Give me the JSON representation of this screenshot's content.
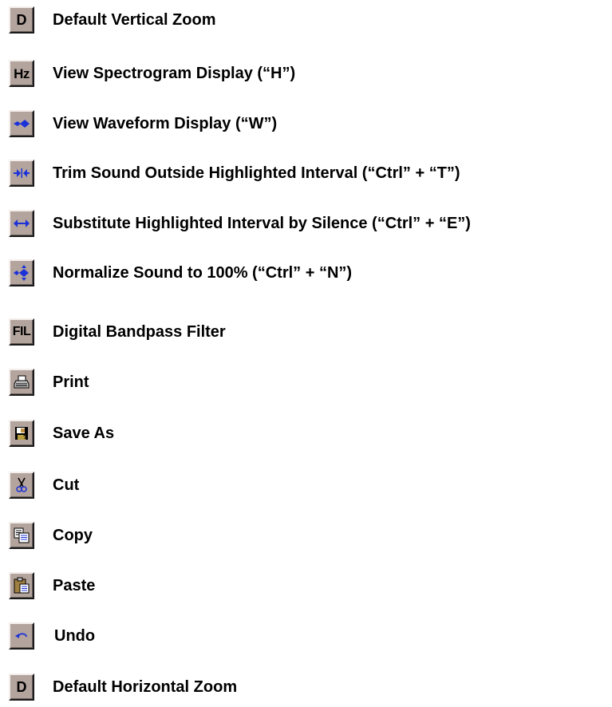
{
  "legend": {
    "items": [
      {
        "icon": "default-vertical-zoom-icon",
        "glyph": "D",
        "label": "Default Vertical Zoom"
      },
      {
        "icon": "spectrogram-icon",
        "glyph": "Hz",
        "label": "View Spectrogram Display (“H”)"
      },
      {
        "icon": "waveform-icon",
        "label": "View Waveform Display (“W”)"
      },
      {
        "icon": "trim-icon",
        "label": "Trim Sound Outside Highlighted Interval (“Ctrl” + “T”)"
      },
      {
        "icon": "silence-icon",
        "label": "Substitute Highlighted Interval by Silence (“Ctrl” + “E”)"
      },
      {
        "icon": "normalize-icon",
        "label": "Normalize Sound to 100% (“Ctrl” + “N”)"
      },
      {
        "icon": "filter-icon",
        "glyph": "FIL",
        "label": "Digital Bandpass Filter"
      },
      {
        "icon": "printer-icon",
        "label": "Print"
      },
      {
        "icon": "save-as-icon",
        "label": "Save As"
      },
      {
        "icon": "scissors-icon",
        "label": "Cut"
      },
      {
        "icon": "copy-icon",
        "label": "Copy"
      },
      {
        "icon": "clipboard-icon",
        "label": "Paste"
      },
      {
        "icon": "undo-icon",
        "label": "Undo"
      },
      {
        "icon": "default-horizontal-zoom-icon",
        "glyph": "D",
        "label": "Default Horizontal Zoom"
      }
    ]
  },
  "colors": {
    "button_face": "#b4a49e",
    "icon_blue": "#1c32d8",
    "label_text": "#000000"
  }
}
